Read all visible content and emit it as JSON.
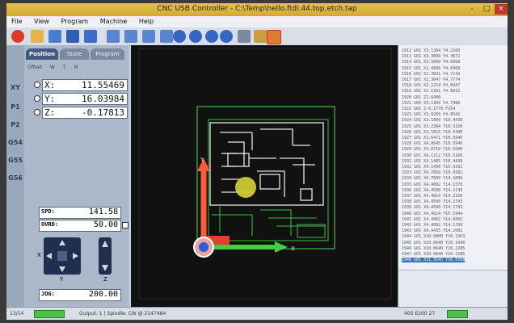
{
  "window": {
    "title": "CNC USB Controller - C:\\Temp\\hello.ftdi.44.top.etch.tap",
    "controls": [
      "-",
      "□",
      "×"
    ]
  },
  "menu": [
    "File",
    "View",
    "Program",
    "Machine",
    "Help"
  ],
  "left_panel": {
    "tabs": [
      "Position",
      "State",
      "Program"
    ],
    "active_tab": "Position",
    "options": [
      "Offset",
      "W",
      "T",
      "M"
    ],
    "ruler_labels": [
      "XY",
      "P1",
      "P2",
      "G54",
      "G55",
      "G56"
    ],
    "axes": [
      {
        "axis": "X:",
        "value": "11.55469"
      },
      {
        "axis": "Y:",
        "value": "16.03984"
      },
      {
        "axis": "Z:",
        "value": "-0.17813"
      }
    ],
    "spd_label": "SPD:",
    "spd_value": "141.58",
    "ovrd_label": "OVRD:",
    "ovrd_value": "50.00",
    "jog_label": "JOG:",
    "jog_value": "200.00",
    "jog_pad_labels": [
      "X",
      "Y",
      "Z"
    ]
  },
  "toolpath_axes": {
    "x": "X",
    "y": "Y"
  },
  "gcode_lines": [
    "1912 G01 X3.1304 Y4.2160",
    "1913 G01 X3.3008 Y4.3672",
    "1914 G01 X3.5009 Y4.6968",
    "1915 G01 X1.4896 Y4.6968",
    "1916 G01 X2.3831 Y4.7119",
    "1917 G01 X2.3047 Y4.7774",
    "1918 G01 X2.2214 Y4.8447",
    "1919 G01 X2.1301 Y4.8912",
    "1920 G01 Z2.0400",
    "1921 G00 X3.1304 Y4.7980",
    "1922 G01 Z-0.1778 F254",
    "1923 G01 X3.0209 Y4.8542",
    "1924 G01 X3.1009 Y10.4438",
    "1925 G01 X3.2304 Y10.5160",
    "1926 G01 X3.5810 Y10.5440",
    "1927 G01 X3.6471 Y10.5940",
    "1928 G01 X4.0645 Y10.5940",
    "1929 G01 X3.0710 Y10.5940",
    "1930 G01 X4.1212 Y10.5160",
    "1931 G01 X4.1495 Y10.4438",
    "1932 G01 X4.1490 Y10.0331",
    "1933 G01 X4.7609 Y10.0582",
    "1934 G01 X4.7609 Y14.1009",
    "1935 G01 X4.4082 Y14.1378",
    "1936 G01 X4.4500 Y14.1743",
    "1937 G01 X4.4814 Y14.2166",
    "1938 G01 X4.4500 Y14.1743",
    "1939 G01 X4.4500 Y14.1743",
    "1940 G01 X4.4824 Y10.1944",
    "1941 G01 X4.4082 Y14.0402",
    "1942 G01 X4.4082 Y14.1760",
    "1943 G01 X4.9435 Y14.1001",
    "1944 G01 X10.0800 Y16.1453",
    "1945 G01 X10.0640 Y16.1940",
    "1946 G01 X10.0640 Y16.2285",
    "1947 G01 X10.0640 Y16.2285",
    "1948 G01 X11.5545 Y16.0398"
  ],
  "gcode_footer": "405 E200 27",
  "status": {
    "lines": "13/14",
    "output": "Output: 1 | Spindle: CW @ 2147484",
    "progress": 0.6,
    "right_progress": 0.7
  },
  "colors": {
    "titlebar": "#d8b13c",
    "trace": "#38c238",
    "x_axis": "#3fd13f",
    "y_axis": "#ff5a3c",
    "tool": "#d8d832"
  }
}
